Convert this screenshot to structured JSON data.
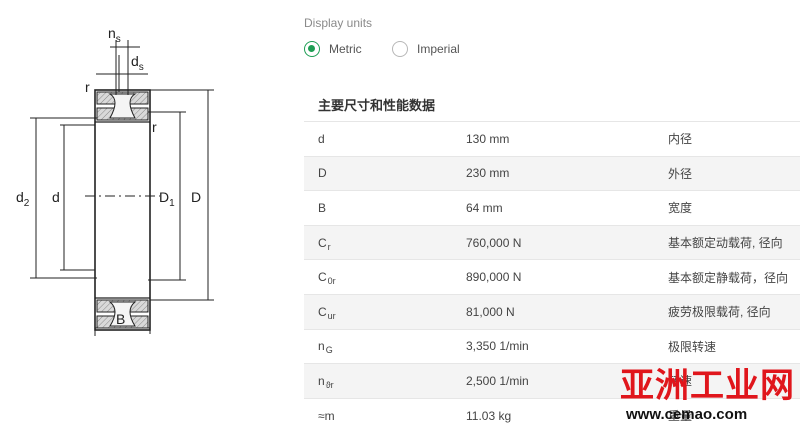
{
  "drawing": {
    "labels": {
      "ns": "n",
      "ns_sub": "s",
      "ds": "d",
      "ds_sub": "s",
      "r_top": "r",
      "r_right": "r",
      "d2": "d",
      "d2_sub": "2",
      "d": "d",
      "D1": "D",
      "D1_sub": "1",
      "D": "D",
      "B": "B"
    }
  },
  "units": {
    "label": "Display units",
    "options": [
      {
        "label": "Metric",
        "selected": true
      },
      {
        "label": "Imperial",
        "selected": false
      }
    ]
  },
  "section": {
    "title": "主要尺寸和性能数据"
  },
  "specs": [
    {
      "symbol": "d",
      "sub": "",
      "value": "130 mm",
      "desc": "内径"
    },
    {
      "symbol": "D",
      "sub": "",
      "value": "230 mm",
      "desc": "外径"
    },
    {
      "symbol": "B",
      "sub": "",
      "value": "64 mm",
      "desc": "宽度"
    },
    {
      "symbol": "C",
      "sub": "r",
      "value": "760,000 N",
      "desc": "基本额定动载荷, 径向"
    },
    {
      "symbol": "C",
      "sub": "0r",
      "value": "890,000 N",
      "desc": "基本额定静载荷，径向"
    },
    {
      "symbol": "C",
      "sub": "ur",
      "value": "81,000 N",
      "desc": "疲劳极限载荷, 径向"
    },
    {
      "symbol": "n",
      "sub": "G",
      "value": "3,350 1/min",
      "desc": "极限转速"
    },
    {
      "symbol": "n",
      "sub": "ϑr",
      "value": "2,500 1/min",
      "desc": "转速"
    },
    {
      "symbol": "≈m",
      "sub": "",
      "value": "11.03 kg",
      "desc": "重量"
    }
  ],
  "watermark": {
    "top": "亚洲工业网",
    "bottom": "www.cemao.com"
  },
  "colors": {
    "accent": "#1e9e54",
    "watermark_red": "#e0161c",
    "row_shade": "#f4f4f4"
  }
}
